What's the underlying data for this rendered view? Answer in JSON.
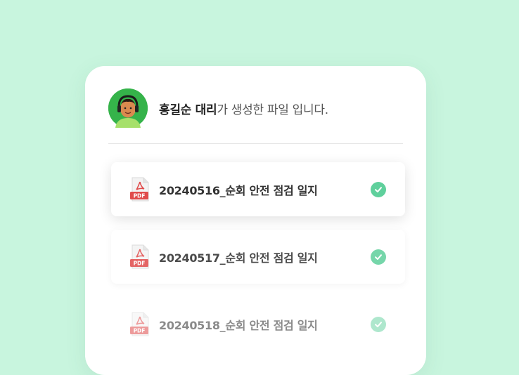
{
  "header": {
    "author_name": "홍길순 대리",
    "message_suffix": "가 생성한 파일 입니다."
  },
  "files": [
    {
      "name": "20240516_순회 안전 점검 일지",
      "badge": "PDF",
      "status": "check-icon"
    },
    {
      "name": "20240517_순회 안전 점검 일지",
      "badge": "PDF",
      "status": "check-icon"
    },
    {
      "name": "20240518_순회 안전 점검 일지",
      "badge": "PDF",
      "status": "check-icon"
    }
  ],
  "colors": {
    "background": "#c8f5de",
    "check": "#5fd09c",
    "pdf": "#e04b4b",
    "avatar_bg": "#35b34a"
  }
}
